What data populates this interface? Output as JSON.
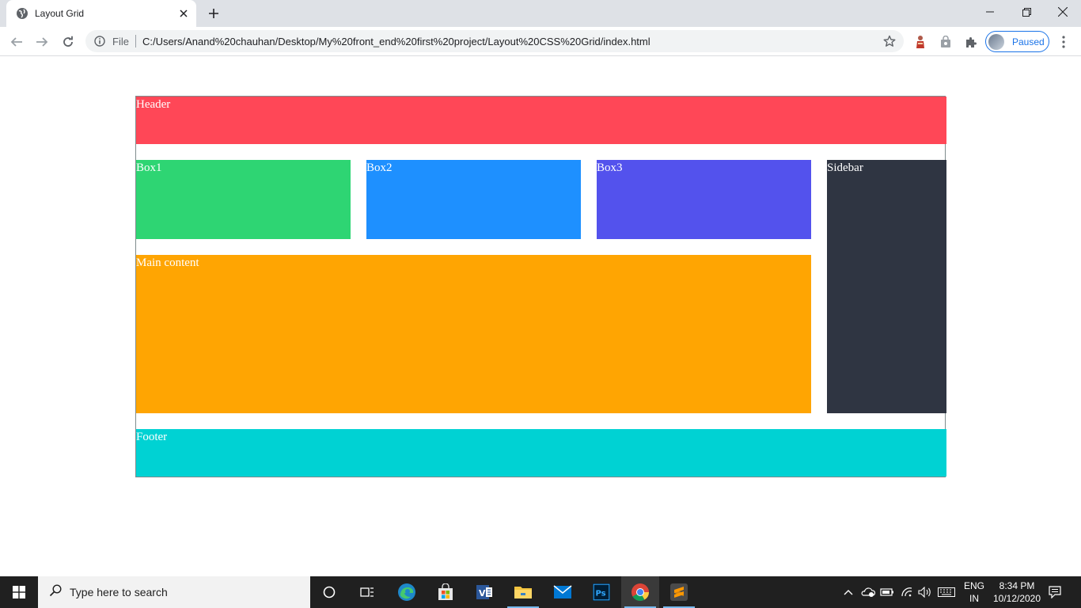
{
  "browser": {
    "tab_title": "Layout Grid",
    "address_scheme": "File",
    "address_url": "C:/Users/Anand%20chauhan/Desktop/My%20front_end%20first%20project/Layout%20CSS%20Grid/index.html",
    "profile_label": "Paused"
  },
  "page": {
    "header": "Header",
    "box1": "Box1",
    "box2": "Box2",
    "box3": "Box3",
    "sidebar": "Sidebar",
    "main": "Main content",
    "footer": "Footer"
  },
  "colors": {
    "header": "#ff4757",
    "box1": "#2ed573",
    "box2": "#1e90ff",
    "box3": "#5352ed",
    "sidebar": "#2f3542",
    "main": "#ffa502",
    "footer": "#00d2d3"
  },
  "taskbar": {
    "search_placeholder": "Type here to search",
    "lang_top": "ENG",
    "lang_bottom": "IN",
    "time": "8:34 PM",
    "date": "10/12/2020",
    "pinned_apps": [
      "cortana-icon",
      "task-view-icon",
      "edge-icon",
      "store-icon",
      "visual-studio-icon",
      "file-explorer-icon",
      "mail-icon",
      "photoshop-icon",
      "chrome-icon",
      "sublime-text-icon"
    ]
  }
}
